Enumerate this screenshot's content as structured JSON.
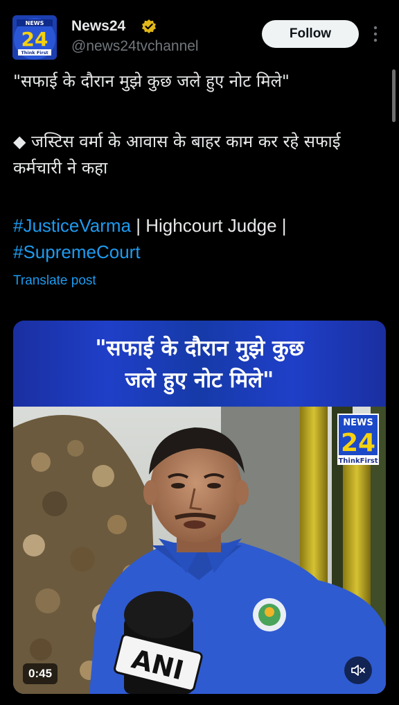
{
  "post": {
    "author": {
      "display_name": "News24",
      "handle": "@news24tvchannel",
      "verified_icon": "verified-badge-icon",
      "avatar_text_top": "NEWS",
      "avatar_text_mid": "24",
      "avatar_text_bottom": "Think First"
    },
    "follow_label": "Follow",
    "more_icon": "more-vertical-icon",
    "text_line1": "\"सफाई के दौरान मुझे कुछ जले हुए नोट मिले\"",
    "text_line2": "◆ जस्टिस वर्मा के आवास के बाहर काम कर रहे सफाई कर्मचारी ने कहा",
    "hashtag1": "#JusticeVarma",
    "middle_text": " | Highcourt Judge | ",
    "hashtag2": "#SupremeCourt",
    "translate_label": "Translate post"
  },
  "media": {
    "banner_line1": "\"सफाई के दौरान मुझे कुछ",
    "banner_line2": "जले हुए नोट मिले\"",
    "logo_top": "NEWS",
    "logo_mid": "24",
    "logo_bottom": "ThinkFirst",
    "mic_label": "ANI",
    "duration": "0:45",
    "mute_icon": "speaker-muted-icon"
  },
  "colors": {
    "background": "#000000",
    "accent": "#1d9bf0",
    "secondary_text": "#71767b",
    "banner_blue": "#1f3fc8"
  }
}
